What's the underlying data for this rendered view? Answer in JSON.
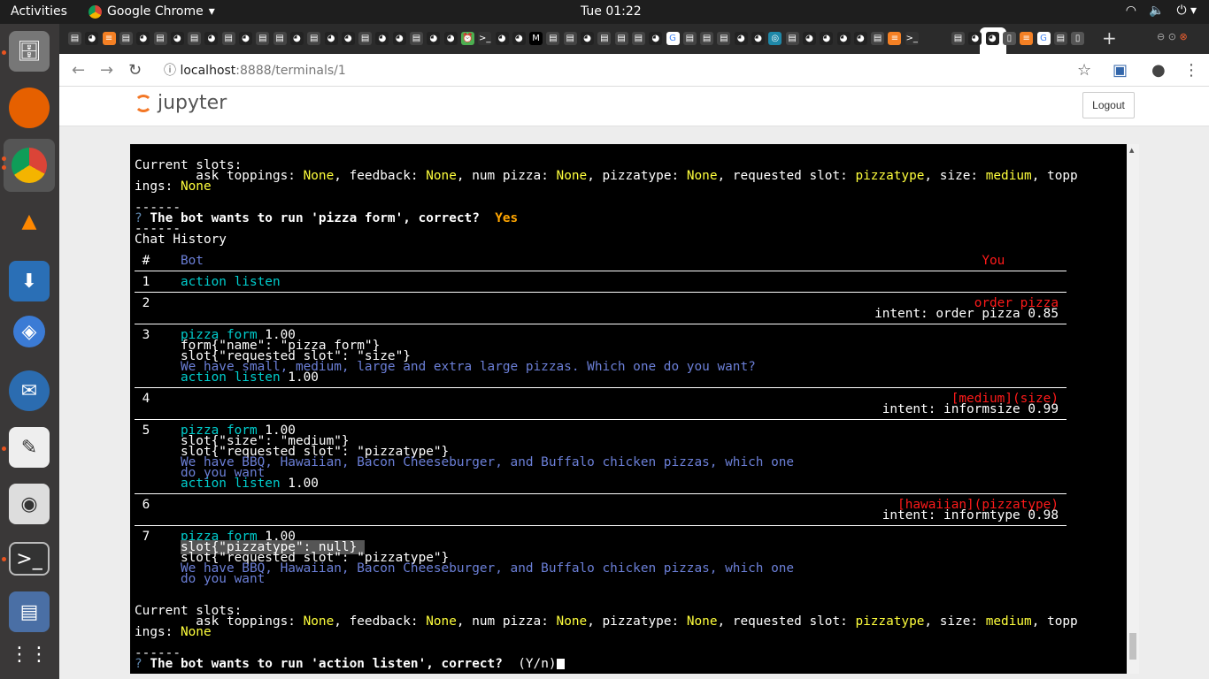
{
  "os": {
    "activities": "Activities",
    "app_name": "Google Chrome",
    "clock": "Tue 01:22"
  },
  "browser": {
    "url_host": "localhost",
    "url_path": ":8888/terminals/1",
    "tab_icons": [
      "jp",
      "gh",
      "so",
      "jp",
      "gh",
      "jp",
      "gh",
      "jp",
      "gh",
      "jp",
      "gh",
      "jp",
      "jp",
      "gh",
      "jp",
      "gh",
      "gh",
      "jp",
      "gh",
      "gh",
      "jp",
      "gh",
      "gh",
      "cl",
      "tm",
      "gh",
      "gh",
      "M",
      "jp",
      "jp",
      "gh",
      "jp",
      "jp",
      "jp",
      "gh",
      "G",
      "jp",
      "jp",
      "jp",
      "gh",
      "gh",
      "ci",
      "jp",
      "gh",
      "gh",
      "gh",
      "gh",
      "jp",
      "so",
      "tm"
    ],
    "tab_icons_after": [
      "jp",
      "gh",
      "gh",
      "pg",
      "so",
      "G",
      "jp",
      "pg"
    ]
  },
  "jupyter": {
    "logo_text": "jupyter",
    "logout": "Logout"
  },
  "colors": {
    "w": "#ffffff",
    "y": "#ffff3c",
    "c": "#00cdcd",
    "u": "#6b7fd7",
    "r": "#ff1a1a",
    "o": "#ffa500",
    "q": "#5f87af"
  },
  "terminal": {
    "lines": [
      {
        "s": [
          [
            "w",
            "Current slots:"
          ]
        ]
      },
      {
        "s": [
          [
            "w",
            "        ask toppings: "
          ],
          [
            "y",
            "None"
          ],
          [
            "w",
            ", feedback: "
          ],
          [
            "y",
            "None"
          ],
          [
            "w",
            ", num pizza: "
          ],
          [
            "y",
            "None"
          ],
          [
            "w",
            ", pizzatype: "
          ],
          [
            "y",
            "None"
          ],
          [
            "w",
            ", requested slot: "
          ],
          [
            "y",
            "pizzatype"
          ],
          [
            "w",
            ", size: "
          ],
          [
            "y",
            "medium"
          ],
          [
            "w",
            ", topp"
          ]
        ]
      },
      {
        "s": [
          [
            "w",
            "ings: "
          ],
          [
            "y",
            "None"
          ]
        ]
      },
      {
        "s": []
      },
      {
        "s": [
          [
            "w",
            "------"
          ]
        ]
      },
      {
        "s": [
          [
            "q",
            "? "
          ],
          [
            "wb",
            "The bot wants to run 'pizza form', correct?  "
          ],
          [
            "ob",
            "Yes"
          ]
        ]
      },
      {
        "s": [
          [
            "w",
            "------"
          ]
        ]
      },
      {
        "s": [
          [
            "w",
            "Chat History"
          ]
        ]
      },
      {
        "s": []
      },
      {
        "s": [
          [
            "w",
            " #    "
          ],
          [
            "u",
            "Bot"
          ]
        ],
        "r": [
          [
            "r",
            "You       "
          ]
        ]
      },
      {
        "rule": true
      },
      {
        "s": [
          [
            "w",
            " 1    "
          ],
          [
            "c",
            "action listen"
          ]
        ]
      },
      {
        "rule": true
      },
      {
        "s": [
          [
            "w",
            " 2"
          ]
        ],
        "r": [
          [
            "r",
            "order pizza"
          ]
        ]
      },
      {
        "s": [],
        "r": [
          [
            "w",
            "intent: order pizza 0.85"
          ]
        ]
      },
      {
        "rule": true
      },
      {
        "s": [
          [
            "w",
            " 3    "
          ],
          [
            "c",
            "pizza form"
          ],
          [
            "w",
            " 1.00"
          ]
        ]
      },
      {
        "s": [
          [
            "w",
            "      form{\"name\": \"pizza form\"}"
          ]
        ]
      },
      {
        "s": [
          [
            "w",
            "      slot{\"requested slot\": \"size\"}"
          ]
        ]
      },
      {
        "s": [
          [
            "u",
            "      We have small, medium, large and extra large pizzas. Which one do you want?"
          ]
        ]
      },
      {
        "s": [
          [
            "c",
            "      action listen"
          ],
          [
            "w",
            " 1.00"
          ]
        ]
      },
      {
        "rule": true
      },
      {
        "s": [
          [
            "w",
            " 4"
          ]
        ],
        "r": [
          [
            "r",
            "[medium](size)"
          ]
        ]
      },
      {
        "s": [],
        "r": [
          [
            "w",
            "intent: informsize 0.99"
          ]
        ]
      },
      {
        "rule": true
      },
      {
        "s": [
          [
            "w",
            " 5    "
          ],
          [
            "c",
            "pizza form"
          ],
          [
            "w",
            " 1.00"
          ]
        ]
      },
      {
        "s": [
          [
            "w",
            "      slot{\"size\": \"medium\"}"
          ]
        ]
      },
      {
        "s": [
          [
            "w",
            "      slot{\"requested slot\": \"pizzatype\"}"
          ]
        ]
      },
      {
        "s": [
          [
            "u",
            "      We have BBQ, Hawaiian, Bacon Cheeseburger, and Buffalo chicken pizzas, which one"
          ]
        ]
      },
      {
        "s": [
          [
            "u",
            "      do you want"
          ]
        ]
      },
      {
        "s": [
          [
            "c",
            "      action listen"
          ],
          [
            "w",
            " 1.00"
          ]
        ]
      },
      {
        "rule": true
      },
      {
        "s": [
          [
            "w",
            " 6"
          ]
        ],
        "r": [
          [
            "r",
            "[hawaiian](pizzatype)"
          ]
        ]
      },
      {
        "s": [],
        "r": [
          [
            "w",
            "intent: informtype 0.98"
          ]
        ]
      },
      {
        "rule": true
      },
      {
        "s": [
          [
            "w",
            " 7    "
          ],
          [
            "c",
            "pizza form"
          ],
          [
            "w",
            " 1.00"
          ]
        ]
      },
      {
        "s": [
          [
            "w",
            "      "
          ],
          [
            "wh",
            "slot{\"pizzatype\": null} "
          ]
        ]
      },
      {
        "s": [
          [
            "w",
            "      slot{\"requested slot\": \"pizzatype\"}"
          ]
        ]
      },
      {
        "s": [
          [
            "u",
            "      We have BBQ, Hawaiian, Bacon Cheeseburger, and Buffalo chicken pizzas, which one"
          ]
        ]
      },
      {
        "s": [
          [
            "u",
            "      do you want"
          ]
        ]
      },
      {
        "s": []
      },
      {
        "s": []
      },
      {
        "s": [
          [
            "w",
            "Current slots:"
          ]
        ]
      },
      {
        "s": [
          [
            "w",
            "        ask toppings: "
          ],
          [
            "y",
            "None"
          ],
          [
            "w",
            ", feedback: "
          ],
          [
            "y",
            "None"
          ],
          [
            "w",
            ", num pizza: "
          ],
          [
            "y",
            "None"
          ],
          [
            "w",
            ", pizzatype: "
          ],
          [
            "y",
            "None"
          ],
          [
            "w",
            ", requested slot: "
          ],
          [
            "y",
            "pizzatype"
          ],
          [
            "w",
            ", size: "
          ],
          [
            "y",
            "medium"
          ],
          [
            "w",
            ", topp"
          ]
        ]
      },
      {
        "s": [
          [
            "w",
            "ings: "
          ],
          [
            "y",
            "None"
          ]
        ]
      },
      {
        "s": []
      },
      {
        "s": [
          [
            "w",
            "------"
          ]
        ]
      },
      {
        "s": [
          [
            "q",
            "? "
          ],
          [
            "wb",
            "The bot wants to run 'action listen', correct?  "
          ],
          [
            "w",
            "(Y/n)"
          ]
        ],
        "cursor": true
      }
    ]
  }
}
